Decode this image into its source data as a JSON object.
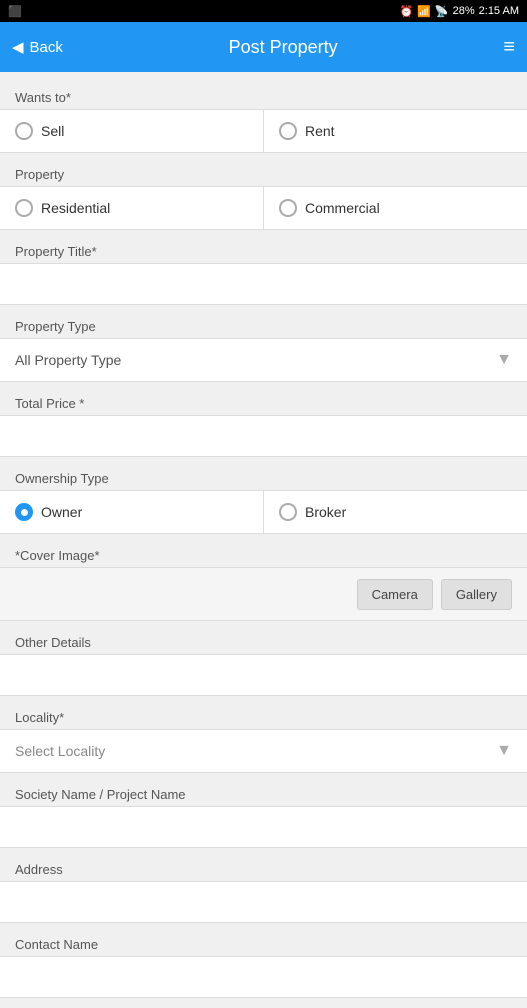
{
  "statusBar": {
    "time": "2:15 AM",
    "battery": "28%"
  },
  "header": {
    "back_label": "Back",
    "title": "Post Property",
    "menu_icon": "≡"
  },
  "form": {
    "wants_to": {
      "label": "Wants to*",
      "options": [
        "Sell",
        "Rent"
      ],
      "selected": "Sell"
    },
    "property": {
      "label": "Property",
      "options": [
        "Residential",
        "Commercial"
      ],
      "selected": "Residential"
    },
    "property_title": {
      "label": "Property Title*",
      "placeholder": ""
    },
    "property_type": {
      "label": "Property Type",
      "placeholder": "All Property Type"
    },
    "total_price": {
      "label": "Total Price *",
      "placeholder": ""
    },
    "ownership_type": {
      "label": "Ownership Type",
      "options": [
        "Owner",
        "Broker"
      ],
      "selected": "Owner"
    },
    "cover_image": {
      "label": "*Cover Image*",
      "camera_label": "Camera",
      "gallery_label": "Gallery"
    },
    "other_details": {
      "label": "Other Details",
      "placeholder": ""
    },
    "locality": {
      "label": "Locality*",
      "placeholder": "Select Locality"
    },
    "society_name": {
      "label": "Society Name / Project Name",
      "placeholder": ""
    },
    "address": {
      "label": "Address",
      "placeholder": ""
    },
    "contact_name": {
      "label": "Contact Name",
      "placeholder": ""
    }
  }
}
